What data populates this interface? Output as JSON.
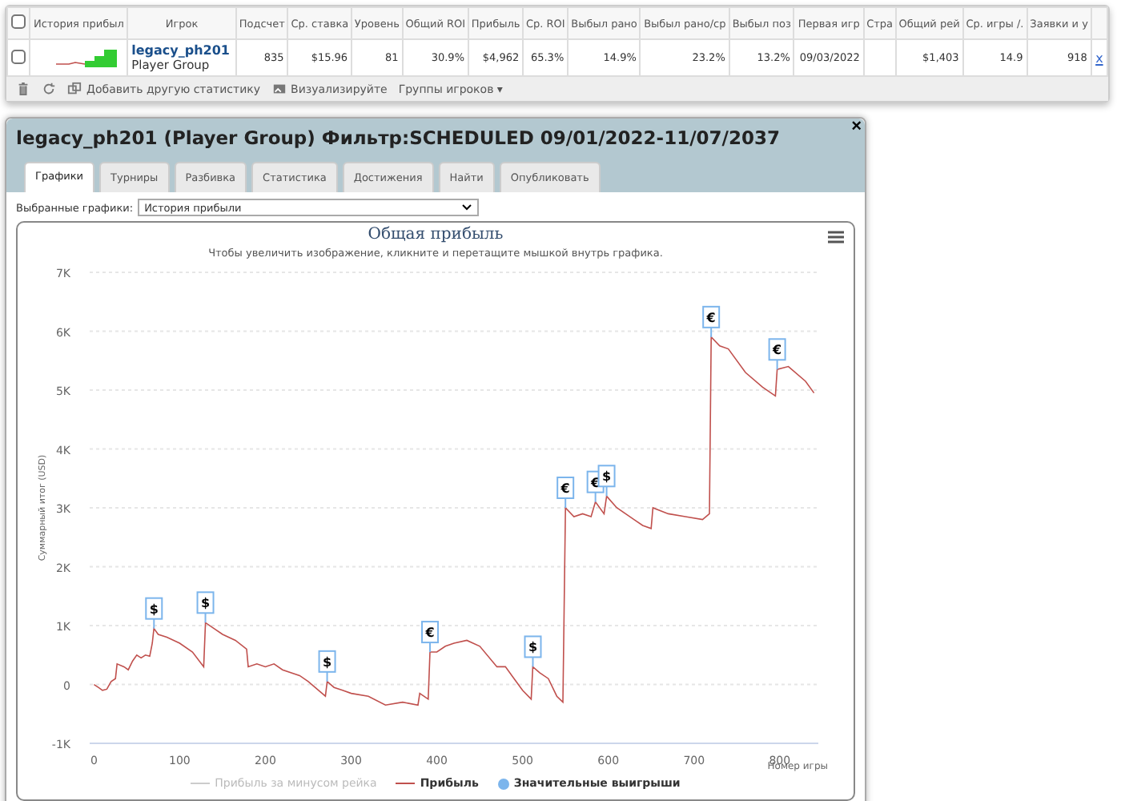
{
  "players_table": {
    "columns": [
      "История прибыл",
      "Игрок",
      "Подсчет",
      "Ср. ставка",
      "Уровень",
      "Общий ROI",
      "Прибыль",
      "Ср. ROI",
      "Выбыл рано",
      "Выбыл рано/ср",
      "Выбыл поз",
      "Первая игр",
      "Стра",
      "Общий рей",
      "Ср. игры /.",
      "Заявки и у"
    ],
    "select_all_checked": false,
    "rows": [
      {
        "checked": false,
        "cells": [
          {
            "kind": "sparkline"
          },
          {
            "kind": "player",
            "name": "legacy_ph201",
            "group": "Player Group"
          },
          "835",
          "$15.96",
          "81",
          "30.9%",
          "$4,962",
          "65.3%",
          "14.9%",
          "23.2%",
          "13.2%",
          "09/03/2022",
          "",
          "$1,403",
          "14.9",
          "918"
        ],
        "remove": "x"
      }
    ],
    "toolbar": {
      "add_stat": "Добавить другую статистику",
      "visualize": "Визуализируйте",
      "groups": "Группы игроков ▾"
    }
  },
  "dialog": {
    "title": "legacy_ph201 (Player Group) Фильтр:SCHEDULED 09/01/2022-11/07/2037",
    "close": "×",
    "tabs": [
      {
        "label": "Графики",
        "selected": true
      },
      {
        "label": "Турниры",
        "selected": false
      },
      {
        "label": "Разбивка",
        "selected": false
      },
      {
        "label": "Статистика",
        "selected": false
      },
      {
        "label": "Достижения",
        "selected": false
      },
      {
        "label": "Найти",
        "selected": false
      },
      {
        "label": "Опубликовать",
        "selected": false
      }
    ],
    "chart_select": {
      "label": "Выбранные графики:",
      "value": "История прибыли"
    },
    "chart": {
      "title": "Общая прибыль",
      "subtitle": "Чтобы увеличить изображение, кликните и перетащите мышкой внутрь графика.",
      "legend": [
        {
          "label": "Прибыль за минусом рейка",
          "kind": "line",
          "visible": false,
          "color": "#cccccc"
        },
        {
          "kind": "series",
          "visible": true
        },
        {
          "label": "Значительные выигрыши",
          "kind": "marker",
          "visible": true,
          "color": "#7cb5ec"
        }
      ],
      "chart_data": {
        "type": "line",
        "xlabel": "Номер игры",
        "ylabel": "Суммарный итог (USD)",
        "x": [
          0,
          5,
          10,
          15,
          20,
          25,
          27,
          35,
          40,
          45,
          50,
          55,
          60,
          65,
          68,
          70,
          75,
          85,
          100,
          115,
          128,
          130,
          140,
          150,
          165,
          178,
          180,
          190,
          200,
          210,
          220,
          240,
          250,
          270,
          272,
          280,
          290,
          300,
          320,
          340,
          360,
          378,
          380,
          390,
          392,
          400,
          410,
          420,
          435,
          450,
          470,
          480,
          490,
          500,
          510,
          512,
          520,
          530,
          540,
          547,
          550,
          560,
          570,
          580,
          585,
          595,
          598,
          610,
          630,
          640,
          650,
          652,
          670,
          690,
          710,
          718,
          720,
          730,
          740,
          760,
          780,
          795,
          797,
          810,
          830,
          840
        ],
        "series": [
          {
            "name": "Прибыль",
            "color": "#c0504d",
            "values": [
              0,
              -50,
              -100,
              -80,
              50,
              100,
              350,
              300,
              250,
              400,
              500,
              450,
              500,
              480,
              700,
              950,
              850,
              800,
              700,
              550,
              300,
              1050,
              950,
              850,
              750,
              600,
              300,
              350,
              300,
              350,
              250,
              150,
              50,
              -200,
              50,
              -50,
              -100,
              -150,
              -200,
              -350,
              -300,
              -350,
              -150,
              -250,
              550,
              550,
              650,
              700,
              750,
              650,
              300,
              300,
              100,
              -100,
              -250,
              300,
              200,
              100,
              -200,
              -300,
              3000,
              2850,
              2900,
              2850,
              3100,
              2900,
              3200,
              3000,
              2800,
              2700,
              2650,
              3000,
              2900,
              2850,
              2800,
              2900,
              5900,
              5750,
              5700,
              5300,
              5050,
              4900,
              5350,
              5400,
              5150,
              4950
            ]
          }
        ],
        "grid": true,
        "xlim": [
          -5,
          845
        ],
        "ylim": [
          -1000,
          7000
        ],
        "xticks": [
          0,
          100,
          200,
          300,
          400,
          500,
          600,
          700,
          800
        ],
        "yticks": [
          {
            "value": -1000,
            "label": "-1K"
          },
          {
            "value": 0,
            "label": "0"
          },
          {
            "value": 1000,
            "label": "1K"
          },
          {
            "value": 2000,
            "label": "2K"
          },
          {
            "value": 3000,
            "label": "3K"
          },
          {
            "value": 4000,
            "label": "4K"
          },
          {
            "value": 5000,
            "label": "5K"
          },
          {
            "value": 6000,
            "label": "6K"
          },
          {
            "value": 7000,
            "label": "7K"
          }
        ],
        "annotations": [
          {
            "x": 70,
            "y": 950,
            "text": "$"
          },
          {
            "x": 130,
            "y": 1050,
            "text": "$"
          },
          {
            "x": 272,
            "y": 50,
            "text": "$"
          },
          {
            "x": 392,
            "y": 550,
            "text": "€"
          },
          {
            "x": 512,
            "y": 300,
            "text": "$"
          },
          {
            "x": 550,
            "y": 3000,
            "text": "€"
          },
          {
            "x": 585,
            "y": 3100,
            "text": "€"
          },
          {
            "x": 598,
            "y": 3200,
            "text": "$"
          },
          {
            "x": 720,
            "y": 5900,
            "text": "€"
          },
          {
            "x": 797,
            "y": 5350,
            "text": "€"
          }
        ]
      }
    }
  }
}
